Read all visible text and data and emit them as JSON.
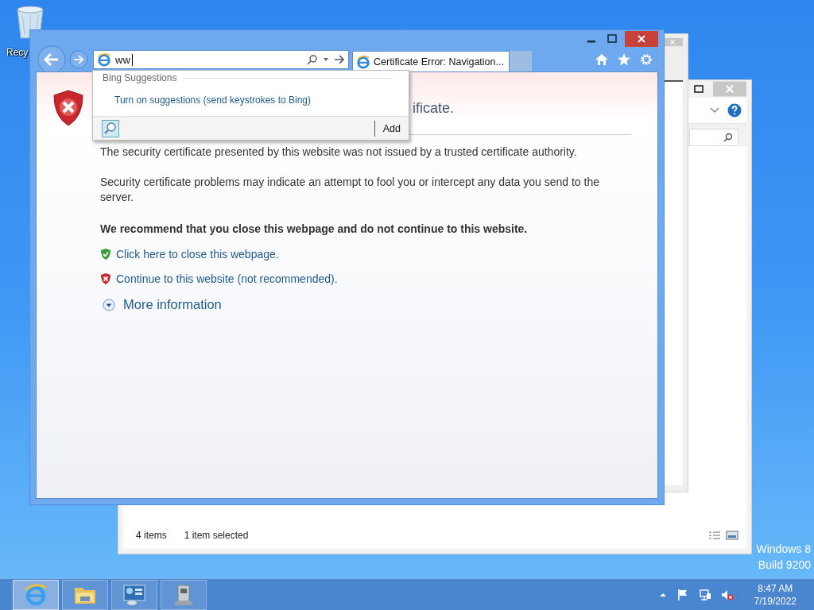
{
  "desktop": {
    "icons": [
      {
        "label": "Recy"
      }
    ],
    "watermark": [
      "Windows 8",
      "Build 9200"
    ]
  },
  "explorer_window": {
    "status_items": "4 items",
    "status_selected": "1 item selected"
  },
  "browser": {
    "address": {
      "value": "ww"
    },
    "tabs": [
      {
        "title": "Certificate Error: Navigation...",
        "selected": true
      }
    ],
    "suggestions": {
      "header": "Bing Suggestions",
      "link": "Turn on suggestions (send keystrokes to Bing)",
      "button": "Add"
    },
    "page": {
      "heading": "ificate.",
      "paragraphs": [
        "The security certificate presented by this website was not issued by a trusted certificate authority.",
        "Security certificate problems may indicate an attempt to fool you or intercept any data you send to the server."
      ],
      "warning": "We recommend that you close this webpage and do not continue to this website.",
      "links": [
        {
          "kind": "safe",
          "text": "Click here to close this webpage."
        },
        {
          "kind": "unsafe",
          "text": "Continue to this website (not recommended)."
        }
      ],
      "more": "More information"
    }
  },
  "taskbar": {
    "apps": [
      {
        "kind": "browser",
        "selected": true
      },
      {
        "kind": "folder",
        "selected": false
      },
      {
        "kind": "server",
        "selected": false
      },
      {
        "kind": "drive",
        "selected": false
      }
    ],
    "tray": {
      "time": "8:47 AM",
      "date": "7/19/2022",
      "sound_muted": true
    }
  }
}
